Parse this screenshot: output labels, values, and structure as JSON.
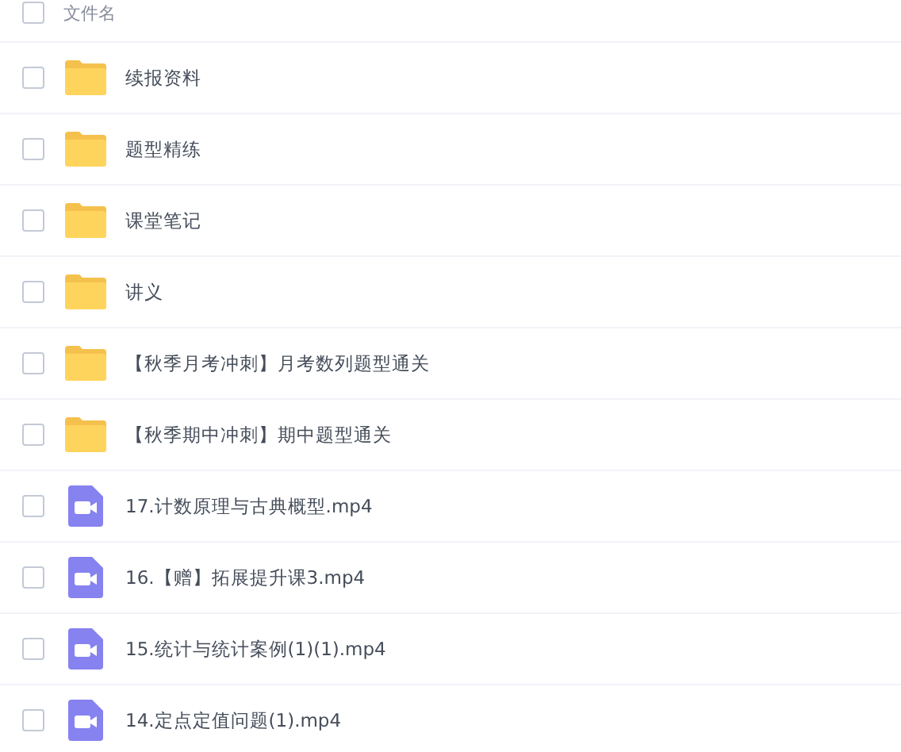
{
  "header": {
    "label": "文件名",
    "checked": false
  },
  "files": [
    {
      "kind": "folder",
      "name": "续报资料",
      "checked": false
    },
    {
      "kind": "folder",
      "name": "题型精练",
      "checked": false
    },
    {
      "kind": "folder",
      "name": "课堂笔记",
      "checked": false
    },
    {
      "kind": "folder",
      "name": "讲义",
      "checked": false
    },
    {
      "kind": "folder",
      "name": "【秋季月考冲刺】月考数列题型通关",
      "checked": false
    },
    {
      "kind": "folder",
      "name": "【秋季期中冲刺】期中题型通关",
      "checked": false
    },
    {
      "kind": "video",
      "name": "17.计数原理与古典概型.mp4",
      "checked": false
    },
    {
      "kind": "video",
      "name": "16.【赠】拓展提升课3.mp4",
      "checked": false
    },
    {
      "kind": "video",
      "name": "15.统计与统计案例(1)(1).mp4",
      "checked": false
    },
    {
      "kind": "video",
      "name": "14.定点定值问题(1).mp4",
      "checked": false
    }
  ]
}
